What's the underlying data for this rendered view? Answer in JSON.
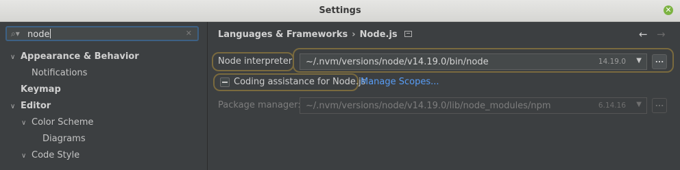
{
  "window": {
    "title": "Settings"
  },
  "sidebar": {
    "search": {
      "value": "node"
    },
    "items": [
      {
        "label": "Appearance & Behavior",
        "expanded": true
      },
      {
        "label": "Notifications"
      },
      {
        "label": "Keymap"
      },
      {
        "label": "Editor",
        "expanded": true
      },
      {
        "label": "Color Scheme",
        "expanded": true
      },
      {
        "label": "Diagrams"
      },
      {
        "label": "Code Style",
        "expanded": true
      }
    ]
  },
  "content": {
    "breadcrumb": [
      "Languages & Frameworks",
      "Node.js"
    ],
    "node_interpreter": {
      "label": "Node interpreter:",
      "value": "~/.nvm/versions/node/v14.19.0/bin/node",
      "version": "14.19.0"
    },
    "coding_assistance": {
      "label": "Coding assistance for Node.js",
      "link": "Manage Scopes..."
    },
    "package_manager": {
      "label": "Package manager:",
      "value": "~/.nvm/versions/node/v14.19.0/lib/node_modules/npm",
      "version": "6.14.16"
    },
    "browse_label": "..."
  },
  "icons": {
    "close": "close-icon",
    "search": "search-icon",
    "clear": "clear-icon",
    "back": "back-arrow-icon",
    "forward": "forward-arrow-icon"
  },
  "colors": {
    "accent": "#589df6",
    "selection_border": "#3d6185",
    "highlight_border": "#7a6a3e"
  }
}
